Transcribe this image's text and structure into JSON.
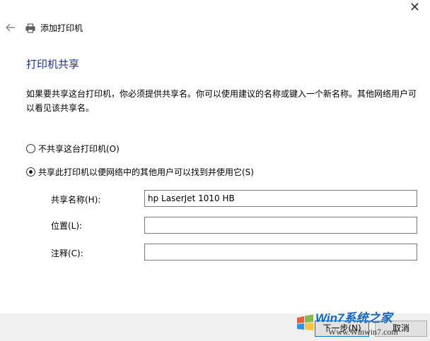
{
  "window": {
    "close_glyph": "✕",
    "wizard_title": "添加打印机",
    "back_icon": "back-arrow-icon",
    "printer_icon": "printer-icon"
  },
  "page": {
    "heading": "打印机共享",
    "description": "如果要共享这台打印机，你必须提供共享名。你可以使用建议的名称或键入一个新名称。其他网络用户可以看见该共享名。"
  },
  "options": {
    "no_share": {
      "label": "不共享这台打印机(O)",
      "selected": false
    },
    "share": {
      "label": "共享此打印机以便网络中的其他用户可以找到并使用它(S)",
      "selected": true
    }
  },
  "fields": {
    "share_name": {
      "label": "共享名称(H):",
      "value": "hp LaserJet 1010 HB"
    },
    "location": {
      "label": "位置(L):",
      "value": ""
    },
    "comment": {
      "label": "注释(C):",
      "value": ""
    }
  },
  "buttons": {
    "next": "下一步(N)",
    "cancel": "取消"
  },
  "watermark": {
    "brand": "Win7系统之家",
    "url": "Www.Winwin7.com"
  },
  "colors": {
    "heading": "#1e3287",
    "footer_bg": "#f0f0f0",
    "primary_border": "#0078d7"
  }
}
